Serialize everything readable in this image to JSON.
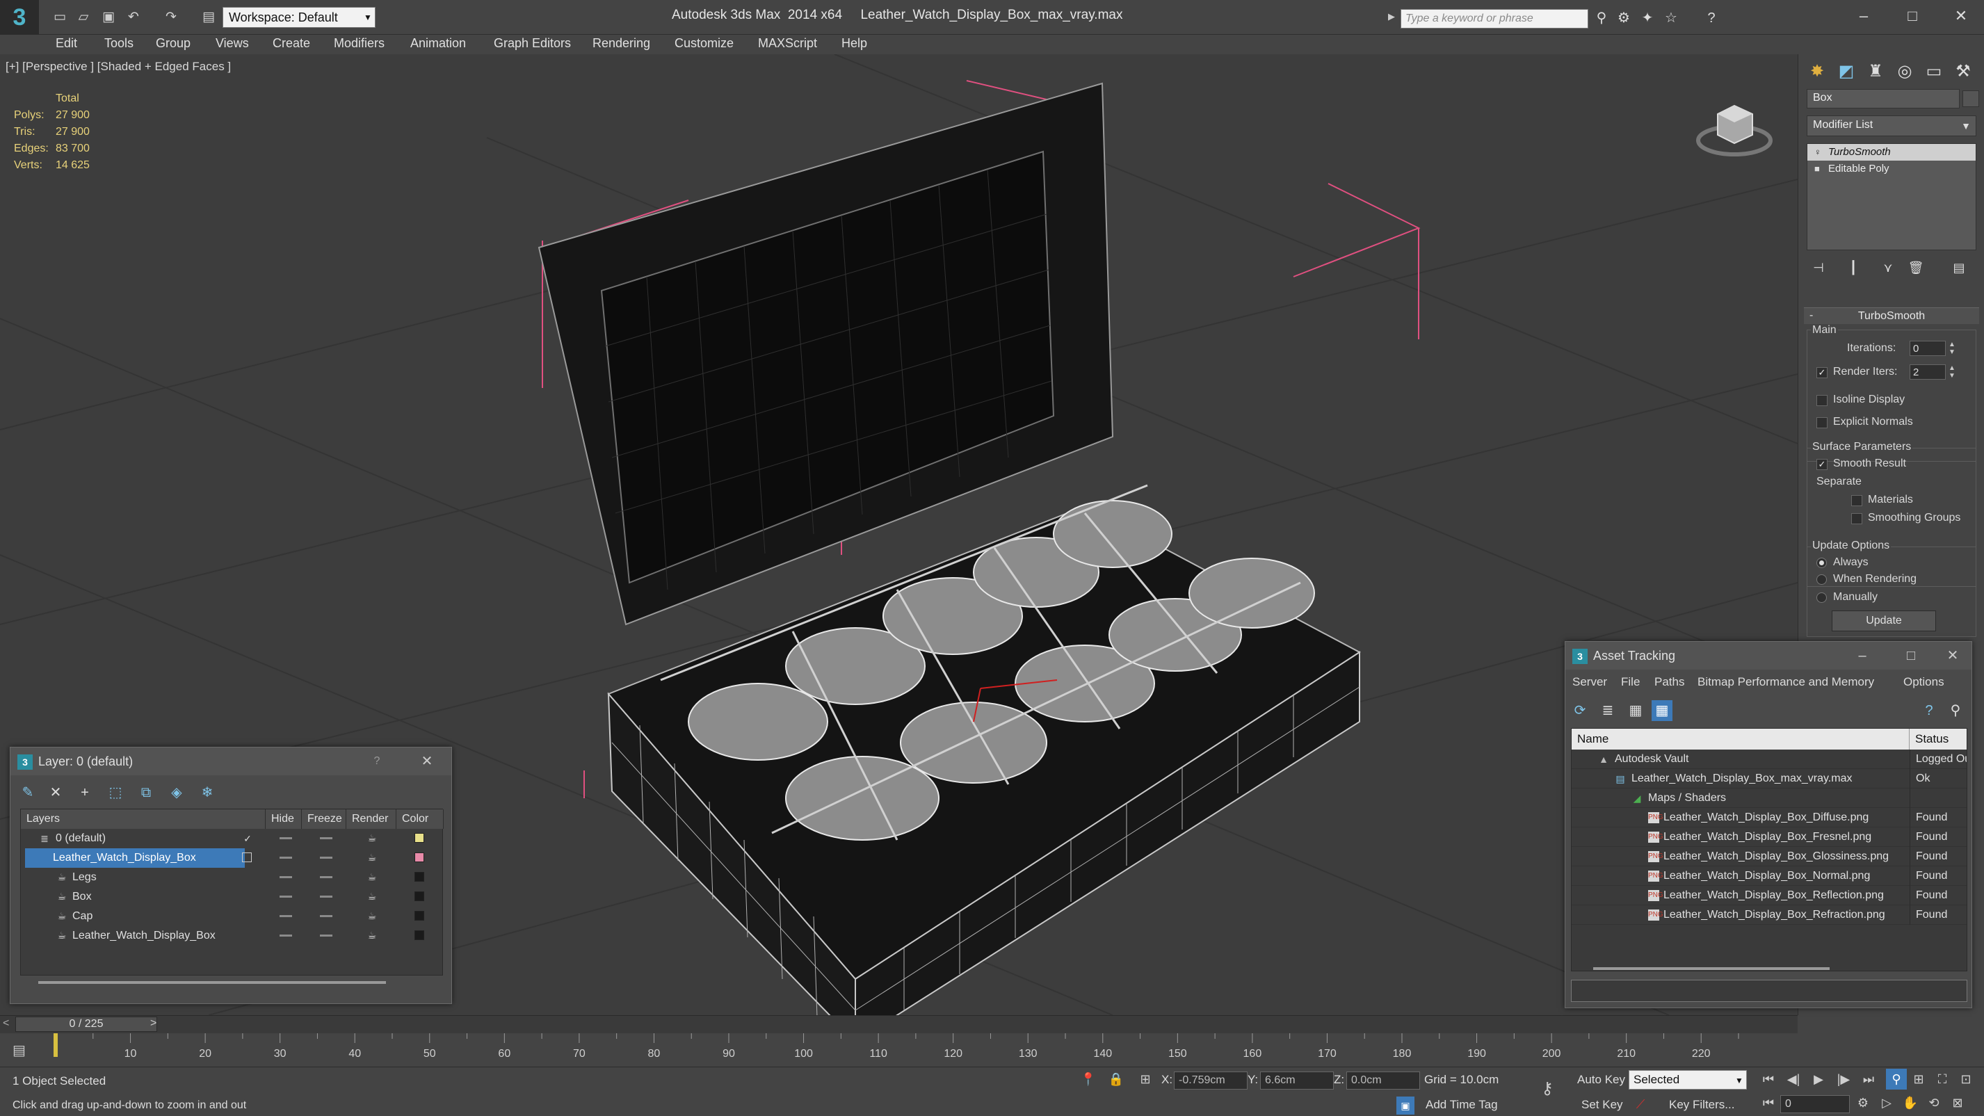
{
  "titlebar": {
    "workspace": "Workspace: Default",
    "app": "Autodesk 3ds Max  2014 x64",
    "file": "Leather_Watch_Display_Box_max_vray.max",
    "search_placeholder": "Type a keyword or phrase"
  },
  "menu": [
    "Edit",
    "Tools",
    "Group",
    "Views",
    "Create",
    "Modifiers",
    "Animation",
    "Graph Editors",
    "Rendering",
    "Customize",
    "MAXScript",
    "Help"
  ],
  "viewport": {
    "label": "[+] [Perspective ] [Shaded + Edged Faces ]",
    "stats": {
      "header": "Total",
      "rows": [
        {
          "label": "Polys:",
          "value": "27 900"
        },
        {
          "label": "Tris:",
          "value": "27 900"
        },
        {
          "label": "Edges:",
          "value": "83 700"
        },
        {
          "label": "Verts:",
          "value": "14 625"
        }
      ]
    }
  },
  "command_panel": {
    "object_name": "Box",
    "modifier_list": "Modifier List",
    "stack": [
      {
        "label": "TurboSmooth",
        "selected": true
      },
      {
        "label": "Editable Poly",
        "selected": false
      }
    ],
    "turbosmooth": {
      "title": "TurboSmooth",
      "main": "Main",
      "iterations_label": "Iterations:",
      "iterations_value": "0",
      "render_iters_label": "Render Iters:",
      "render_iters_value": "2",
      "isoline": "Isoline Display",
      "explicit_normals": "Explicit Normals",
      "surface_params": "Surface Parameters",
      "smooth_result": "Smooth Result",
      "separate": "Separate",
      "materials": "Materials",
      "smoothing_groups": "Smoothing Groups",
      "update_options": "Update Options",
      "always": "Always",
      "when_rendering": "When Rendering",
      "manually": "Manually",
      "update_button": "Update"
    }
  },
  "layer_dialog": {
    "title": "Layer: 0 (default)",
    "help": "?",
    "columns": [
      "Layers",
      "Hide",
      "Freeze",
      "Render",
      "Color"
    ],
    "rows": [
      {
        "name": "0 (default)",
        "indent": 0,
        "kind": "layer",
        "active": true,
        "color": "#e8e08a"
      },
      {
        "name": "Leather_Watch_Display_Box",
        "indent": 0,
        "kind": "layer",
        "selected": true,
        "color": "#e88aa8"
      },
      {
        "name": "Legs",
        "indent": 1,
        "kind": "object",
        "color": "#1a1a1a"
      },
      {
        "name": "Box",
        "indent": 1,
        "kind": "object",
        "color": "#1a1a1a"
      },
      {
        "name": "Cap",
        "indent": 1,
        "kind": "object",
        "color": "#1a1a1a"
      },
      {
        "name": "Leather_Watch_Display_Box",
        "indent": 1,
        "kind": "object",
        "color": "#1a1a1a"
      }
    ]
  },
  "asset_dialog": {
    "title": "Asset Tracking",
    "menu": [
      "Server",
      "File",
      "Paths",
      "Bitmap Performance and Memory",
      "Options"
    ],
    "columns": [
      "Name",
      "Status"
    ],
    "rows": [
      {
        "name": "Autodesk Vault",
        "status": "Logged Out",
        "indent": 1,
        "kind": "vault"
      },
      {
        "name": "Leather_Watch_Display_Box_max_vray.max",
        "status": "Ok",
        "indent": 2,
        "kind": "max"
      },
      {
        "name": "Maps / Shaders",
        "status": "",
        "indent": 3,
        "kind": "maps"
      },
      {
        "name": "Leather_Watch_Display_Box_Diffuse.png",
        "status": "Found",
        "indent": 4,
        "kind": "png"
      },
      {
        "name": "Leather_Watch_Display_Box_Fresnel.png",
        "status": "Found",
        "indent": 4,
        "kind": "png"
      },
      {
        "name": "Leather_Watch_Display_Box_Glossiness.png",
        "status": "Found",
        "indent": 4,
        "kind": "png"
      },
      {
        "name": "Leather_Watch_Display_Box_Normal.png",
        "status": "Found",
        "indent": 4,
        "kind": "png"
      },
      {
        "name": "Leather_Watch_Display_Box_Reflection.png",
        "status": "Found",
        "indent": 4,
        "kind": "png"
      },
      {
        "name": "Leather_Watch_Display_Box_Refraction.png",
        "status": "Found",
        "indent": 4,
        "kind": "png"
      }
    ]
  },
  "timeline": {
    "frame": "0 / 225",
    "ticks": [
      0,
      10,
      20,
      30,
      40,
      50,
      60,
      70,
      80,
      90,
      100,
      110,
      120,
      130,
      140,
      150,
      160,
      170,
      180,
      190,
      200,
      210,
      220
    ],
    "end": 225
  },
  "status": {
    "selection": "1 Object Selected",
    "prompt": "Click and drag up-and-down to zoom in and out",
    "x": "-0.759cm",
    "y": "6.6cm",
    "z": "0.0cm",
    "x_label": "X:",
    "y_label": "Y:",
    "z_label": "Z:",
    "grid": "Grid = 10.0cm",
    "add_time_tag": "Add Time Tag",
    "auto_key": "Auto Key",
    "set_key": "Set Key",
    "key_mode": "Selected",
    "key_filters": "Key Filters...",
    "current_frame": "0"
  },
  "colors": {
    "accent": "#3d7ab8",
    "stats": "#e8d27a",
    "selection_bbox": "#e05080"
  }
}
